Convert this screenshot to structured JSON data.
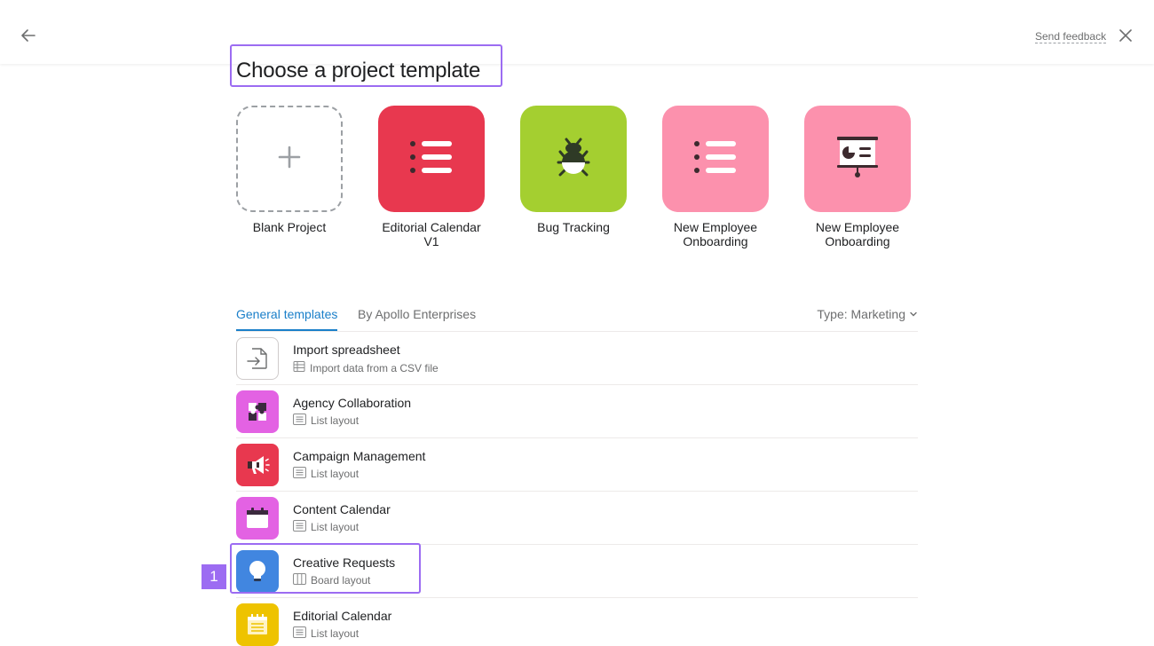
{
  "header": {
    "feedback_label": "Send feedback",
    "back_icon": "arrow-left-icon",
    "close_icon": "close-icon"
  },
  "page": {
    "title": "Choose a project template"
  },
  "tiles": [
    {
      "label": "Blank Project",
      "color": "#ffffff",
      "icon": "plus-icon"
    },
    {
      "label": "Editorial Calendar V1",
      "color": "#e8384f",
      "icon": "list-icon"
    },
    {
      "label": "Bug Tracking",
      "color": "#a4cf30",
      "icon": "bug-icon"
    },
    {
      "label": "New Employee Onboarding",
      "color": "#fc91ad",
      "icon": "list-icon"
    },
    {
      "label": "New Employee Onboarding",
      "color": "#fc91ad",
      "icon": "presentation-icon"
    }
  ],
  "tabs": {
    "general": "General templates",
    "company": "By Apollo Enterprises",
    "type_filter": "Type: Marketing"
  },
  "templates": [
    {
      "title": "Import spreadsheet",
      "subtitle": "Import data from a CSV file",
      "color": "#ffffff",
      "icon": "import-file-icon",
      "sub_icon": "spreadsheet-icon"
    },
    {
      "title": "Agency Collaboration",
      "subtitle": "List layout",
      "color": "#e362e3",
      "icon": "puzzle-icon",
      "sub_icon": "list-layout-icon"
    },
    {
      "title": "Campaign Management",
      "subtitle": "List layout",
      "color": "#e8384f",
      "icon": "megaphone-icon",
      "sub_icon": "list-layout-icon"
    },
    {
      "title": "Content Calendar",
      "subtitle": "List layout",
      "color": "#e362e3",
      "icon": "calendar-icon",
      "sub_icon": "list-layout-icon"
    },
    {
      "title": "Creative Requests",
      "subtitle": "Board layout",
      "color": "#4186e0",
      "icon": "lightbulb-icon",
      "sub_icon": "board-layout-icon"
    },
    {
      "title": "Editorial Calendar",
      "subtitle": "List layout",
      "color": "#eec300",
      "icon": "notepad-icon",
      "sub_icon": "list-layout-icon"
    }
  ],
  "annotation": {
    "marker_label": "1"
  }
}
